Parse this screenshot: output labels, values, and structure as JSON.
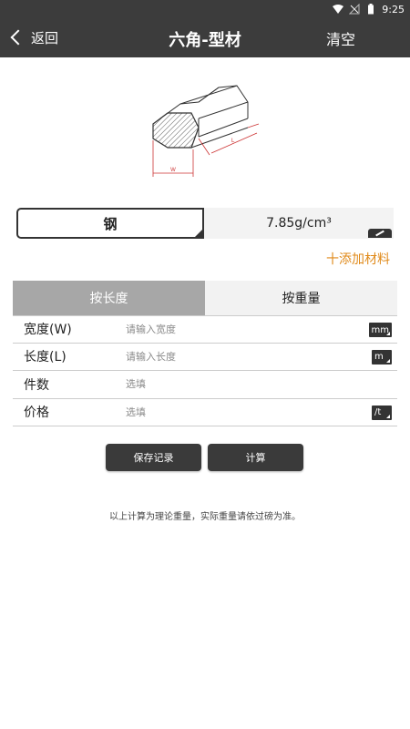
{
  "status": {
    "time": "9:25"
  },
  "header": {
    "back_label": "返回",
    "title": "六角-型材",
    "clear_label": "清空"
  },
  "illustration": {
    "w_label": "W",
    "l_label": "L"
  },
  "material": {
    "name": "钢",
    "density": "7.85g/cm³"
  },
  "add_material_label": "十添加材料",
  "tabs": [
    {
      "label": "按长度"
    },
    {
      "label": "按重量"
    }
  ],
  "form": {
    "rows": [
      {
        "label": "宽度(W)",
        "placeholder": "请输入宽度",
        "unit": "mm"
      },
      {
        "label": "长度(L)",
        "placeholder": "请输入长度",
        "unit": "m"
      },
      {
        "label": "件数",
        "placeholder": "选填"
      },
      {
        "label": "价格",
        "placeholder": "选填",
        "unit": "/t"
      }
    ]
  },
  "buttons": {
    "save_label": "保存记录",
    "calc_label": "计算"
  },
  "note": "以上计算为理论重量，实际重量请依过磅为准。",
  "colors": {
    "header_bg": "#3c3c3c",
    "accent": "#e08a1a",
    "tab_active": "#a7a7a7"
  },
  "icons": [
    "wifi-icon",
    "signal-off-icon",
    "battery-icon",
    "back-chevron-icon",
    "edit-icon"
  ]
}
